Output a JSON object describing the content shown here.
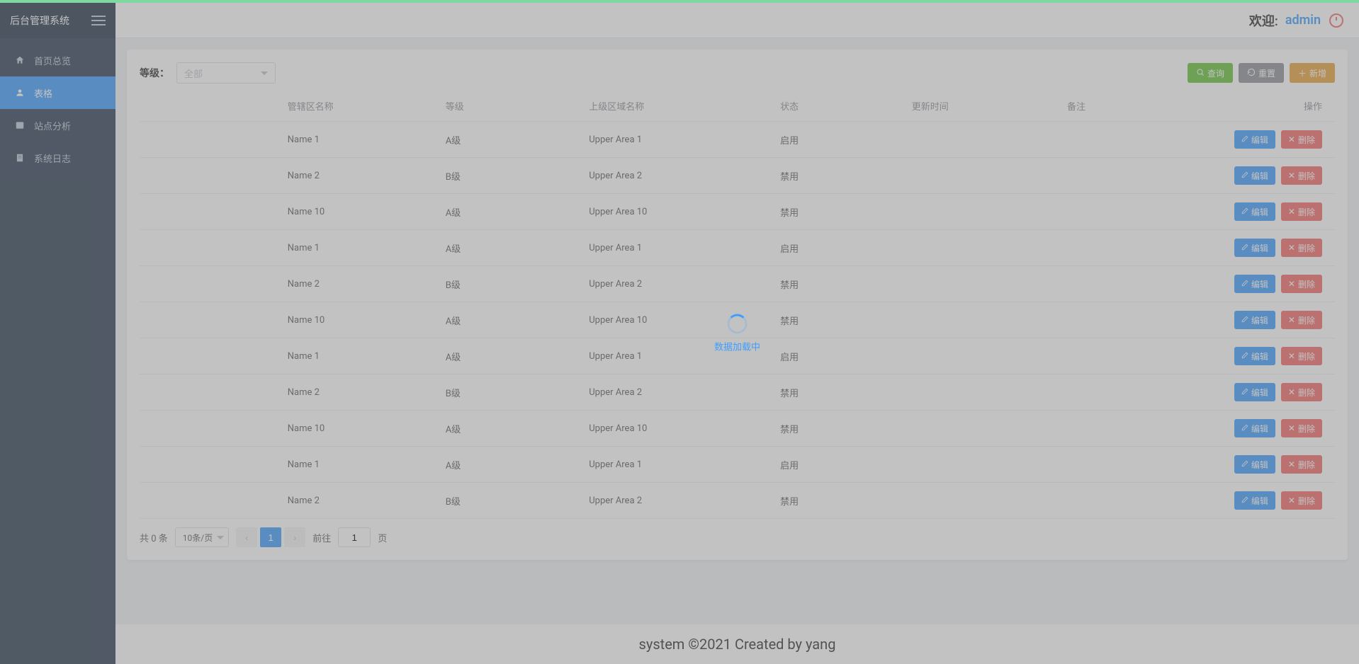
{
  "sidebar": {
    "title": "后台管理系统",
    "items": [
      {
        "label": "首页总览",
        "icon": "home-icon",
        "active": false
      },
      {
        "label": "表格",
        "icon": "table-icon",
        "active": true
      },
      {
        "label": "站点分析",
        "icon": "chart-icon",
        "active": false
      },
      {
        "label": "系统日志",
        "icon": "log-icon",
        "active": false
      }
    ]
  },
  "header": {
    "welcome_prefix": "欢迎:",
    "username": "admin"
  },
  "toolbar": {
    "filter_label": "等级：",
    "filter_placeholder": "全部",
    "search_label": "查询",
    "reset_label": "重置",
    "add_label": "新增"
  },
  "table": {
    "headers": {
      "name": "管辖区名称",
      "level": "等级",
      "upper": "上级区域名称",
      "status": "状态",
      "update": "更新时间",
      "remark": "备注",
      "ops": "操作"
    },
    "row_actions": {
      "edit": "编辑",
      "delete": "删除"
    },
    "rows": [
      {
        "name": "Name 1",
        "level": "A级",
        "upper": "Upper Area 1",
        "status": "启用",
        "update": "",
        "remark": ""
      },
      {
        "name": "Name 2",
        "level": "B级",
        "upper": "Upper Area 2",
        "status": "禁用",
        "update": "",
        "remark": ""
      },
      {
        "name": "Name 10",
        "level": "A级",
        "upper": "Upper Area 10",
        "status": "禁用",
        "update": "",
        "remark": ""
      },
      {
        "name": "Name 1",
        "level": "A级",
        "upper": "Upper Area 1",
        "status": "启用",
        "update": "",
        "remark": ""
      },
      {
        "name": "Name 2",
        "level": "B级",
        "upper": "Upper Area 2",
        "status": "禁用",
        "update": "",
        "remark": ""
      },
      {
        "name": "Name 10",
        "level": "A级",
        "upper": "Upper Area 10",
        "status": "禁用",
        "update": "",
        "remark": ""
      },
      {
        "name": "Name 1",
        "level": "A级",
        "upper": "Upper Area 1",
        "status": "启用",
        "update": "",
        "remark": ""
      },
      {
        "name": "Name 2",
        "level": "B级",
        "upper": "Upper Area 2",
        "status": "禁用",
        "update": "",
        "remark": ""
      },
      {
        "name": "Name 10",
        "level": "A级",
        "upper": "Upper Area 10",
        "status": "禁用",
        "update": "",
        "remark": ""
      },
      {
        "name": "Name 1",
        "level": "A级",
        "upper": "Upper Area 1",
        "status": "启用",
        "update": "",
        "remark": ""
      },
      {
        "name": "Name 2",
        "level": "B级",
        "upper": "Upper Area 2",
        "status": "禁用",
        "update": "",
        "remark": ""
      }
    ]
  },
  "pagination": {
    "total_text": "共 0 条",
    "page_size_label": "10条/页",
    "current_page": "1",
    "goto_prefix": "前往",
    "goto_value": "1",
    "goto_suffix": "页"
  },
  "loading": {
    "text": "数据加载中"
  },
  "footer": {
    "text": "system ©2021 Created by yang"
  }
}
